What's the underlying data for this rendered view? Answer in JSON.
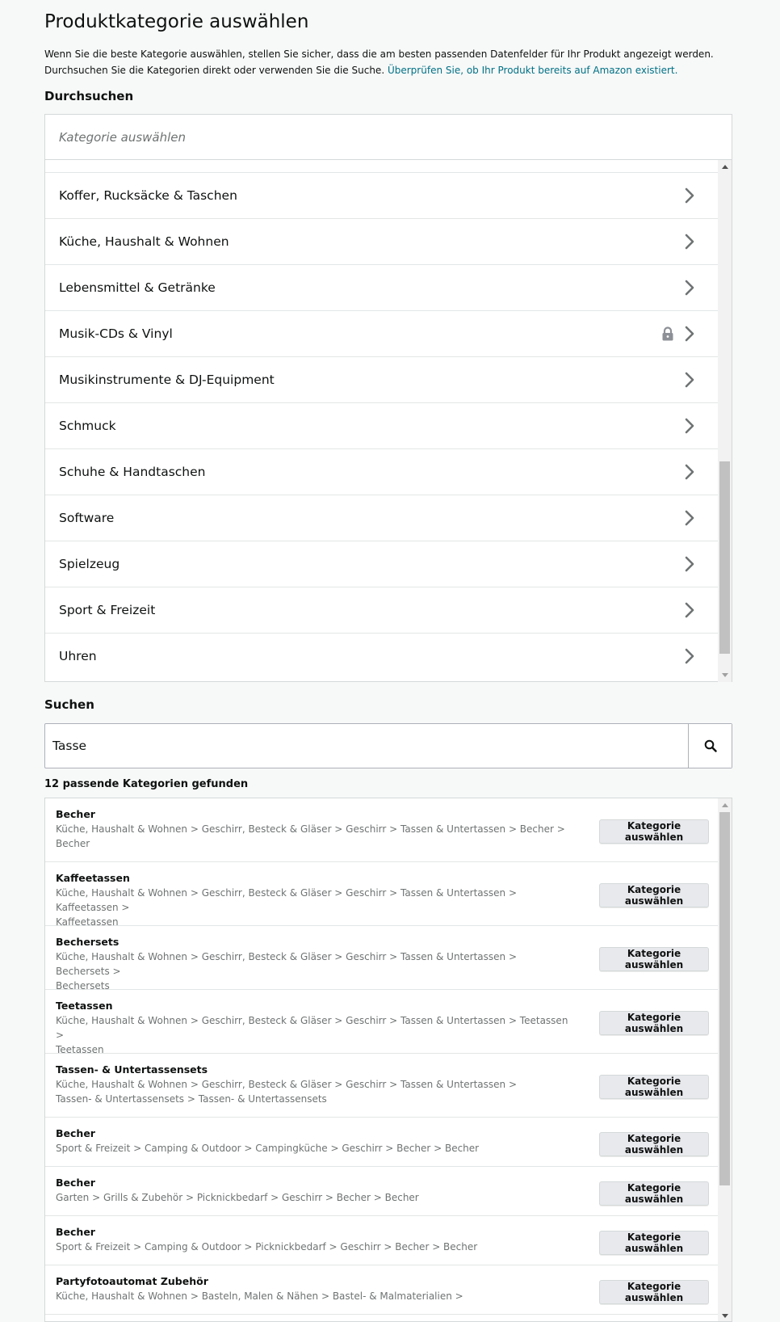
{
  "header": {
    "title": "Produktkategorie auswählen",
    "intro_line1": "Wenn Sie die beste Kategorie auswählen, stellen Sie sicher, dass die am besten passenden Datenfelder für Ihr Produkt angezeigt werden.",
    "intro_line2": "Durchsuchen Sie die Kategorien direkt oder verwenden Sie die Suche.",
    "intro_link": "Überprüfen Sie, ob Ihr Produkt bereits auf Amazon existiert."
  },
  "browse": {
    "label": "Durchsuchen",
    "placeholder": "Kategorie auswählen",
    "items": [
      {
        "label": "Koffer, Rucksäcke & Taschen",
        "locked": false
      },
      {
        "label": "Küche, Haushalt & Wohnen",
        "locked": false
      },
      {
        "label": "Lebensmittel & Getränke",
        "locked": false
      },
      {
        "label": "Musik-CDs & Vinyl",
        "locked": true
      },
      {
        "label": "Musikinstrumente & DJ-Equipment",
        "locked": false
      },
      {
        "label": "Schmuck",
        "locked": false
      },
      {
        "label": "Schuhe & Handtaschen",
        "locked": false
      },
      {
        "label": "Software",
        "locked": false
      },
      {
        "label": "Spielzeug",
        "locked": false
      },
      {
        "label": "Sport & Freizeit",
        "locked": false
      },
      {
        "label": "Uhren",
        "locked": false
      }
    ]
  },
  "search": {
    "label": "Suchen",
    "value": "Tasse",
    "result_count": "12 passende Kategorien gefunden"
  },
  "results": {
    "select_label": "Kategorie auswählen",
    "items": [
      {
        "name": "Becher",
        "path": [
          "Küche, Haushalt & Wohnen > Geschirr, Besteck & Gläser > Geschirr > Tassen & Untertassen > Becher >",
          "Becher"
        ]
      },
      {
        "name": "Kaffeetassen",
        "path": [
          "Küche, Haushalt & Wohnen > Geschirr, Besteck & Gläser > Geschirr > Tassen & Untertassen > Kaffeetassen >",
          "Kaffeetassen"
        ]
      },
      {
        "name": "Bechersets",
        "path": [
          "Küche, Haushalt & Wohnen > Geschirr, Besteck & Gläser > Geschirr > Tassen & Untertassen > Bechersets >",
          "Bechersets"
        ]
      },
      {
        "name": "Teetassen",
        "path": [
          "Küche, Haushalt & Wohnen > Geschirr, Besteck & Gläser > Geschirr > Tassen & Untertassen > Teetassen >",
          "Teetassen"
        ]
      },
      {
        "name": "Tassen- & Untertassensets",
        "path": [
          "Küche, Haushalt & Wohnen > Geschirr, Besteck & Gläser > Geschirr > Tassen & Untertassen >",
          "Tassen- & Untertassensets > Tassen- & Untertassensets"
        ]
      },
      {
        "name": "Becher",
        "path": [
          "Sport & Freizeit > Camping & Outdoor > Campingküche > Geschirr > Becher > Becher"
        ]
      },
      {
        "name": "Becher",
        "path": [
          "Garten > Grills & Zubehör > Picknickbedarf > Geschirr > Becher > Becher"
        ]
      },
      {
        "name": "Becher",
        "path": [
          "Sport & Freizeit > Camping & Outdoor > Picknickbedarf > Geschirr > Becher > Becher"
        ]
      },
      {
        "name": "Partyfotoautomat Zubehör",
        "path": [
          "Küche, Haushalt & Wohnen > Basteln, Malen & Nähen > Bastel- & Malmaterialien >"
        ]
      }
    ]
  },
  "colors": {
    "link": "#007185",
    "border": "#d5d9d9",
    "muted_text": "#6f7373",
    "button_bg": "#e7e9ec"
  }
}
